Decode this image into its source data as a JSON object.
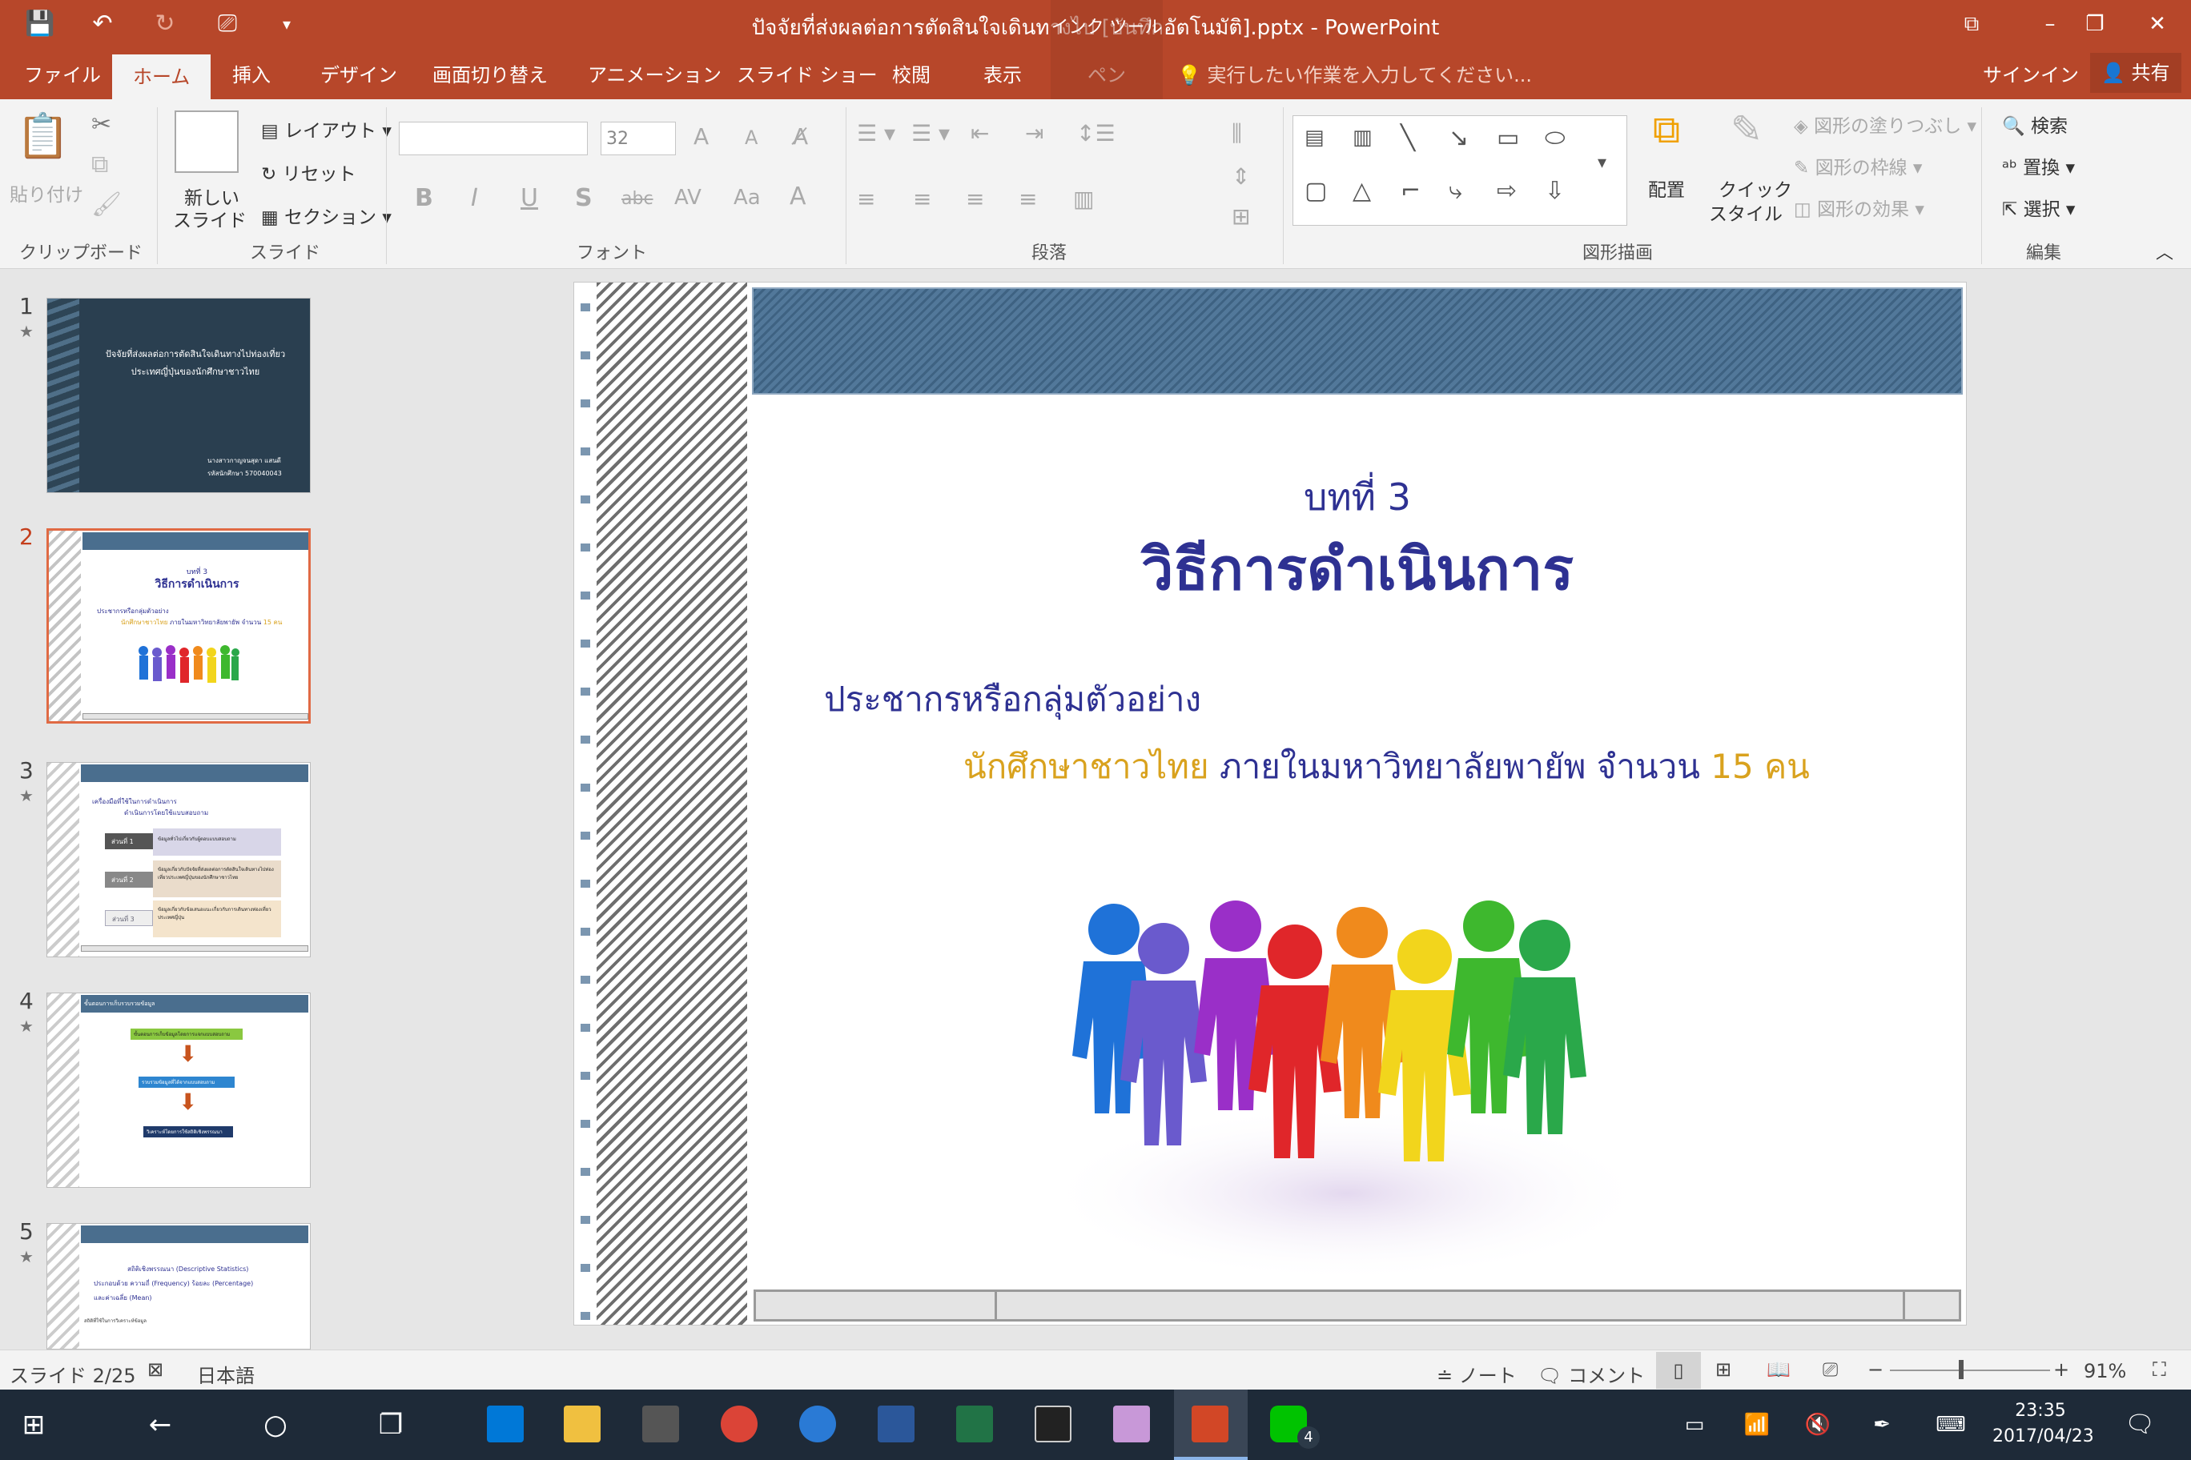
{
  "window": {
    "title": "ปัจจัยที่ส่งผลต่อการตัดสินใจเดินทางไป [บันทึกอัตโนมัติ].pptx - PowerPoint",
    "context_tab_group": "インク ツール",
    "minimize": "–",
    "maximize": "❐",
    "close": "✕",
    "ribbon_display": "⧉"
  },
  "qat": {
    "save": "💾",
    "undo": "↶",
    "redo": "↻",
    "present": "⎚",
    "customize": "▾"
  },
  "tabs": [
    "ファイル",
    "ホーム",
    "挿入",
    "デザイン",
    "画面切り替え",
    "アニメーション",
    "スライド ショー",
    "校閲",
    "表示",
    "ペン"
  ],
  "active_tab": "ホーム",
  "tell_me": "実行したい作業を入力してください...",
  "signin": "サインイン",
  "share": "共有",
  "ribbon": {
    "clipboard": {
      "paste": "貼り付け",
      "group": "クリップボード"
    },
    "slides": {
      "new_slide": "新しい",
      "new_slide2": "スライド",
      "layout": "レイアウト",
      "reset": "リセット",
      "section": "セクション",
      "group": "スライド"
    },
    "font": {
      "font_name": "",
      "font_size": "32",
      "bold": "B",
      "italic": "I",
      "underline": "U",
      "shadow": "S",
      "strike": "abc",
      "spacing": "AV",
      "case": "Aa",
      "color": "A",
      "grow": "A",
      "shrink": "A",
      "group": "フォント"
    },
    "paragraph": {
      "group": "段落"
    },
    "drawing": {
      "arrange": "配置",
      "quick_style": "クイック",
      "quick_style2": "スタイル",
      "fill": "図形の塗りつぶし",
      "outline": "図形の枠線",
      "effects": "図形の効果",
      "group": "図形描画"
    },
    "editing": {
      "find": "検索",
      "replace": "置換",
      "select": "選択",
      "group": "編集"
    }
  },
  "thumbnails": [
    {
      "num": "1",
      "title": "ปัจจัยที่ส่งผลต่อการตัดสินใจเดินทางไปท่องเที่ยว",
      "title2": "ประเทศญี่ปุ่นของนักศึกษาชาวไทย",
      "author": "นางสาวกาญจนสุดา แสนดี",
      "id": "รหัสนักศึกษา 570040043"
    },
    {
      "num": "2",
      "heading": "บทที่ 3",
      "title": "วิธีการดำเนินการ",
      "line1": "ประชากรหรือกลุ่มตัวอย่าง",
      "line2a": "นักศึกษาชาวไทย",
      "line2b": "ภายในมหาวิทยาลัยพายัพ จำนวน",
      "line2c": "15 คน"
    },
    {
      "num": "3",
      "title": "เครื่องมือที่ใช้ในการดำเนินการ",
      "subtitle": "ดำเนินการโดยใช้แบบสอบถาม",
      "parts": [
        {
          "label": "ส่วนที่ 1",
          "text": "ข้อมูลทั่วไปเกี่ยวกับผู้ตอบแบบสอบถาม"
        },
        {
          "label": "ส่วนที่ 2",
          "text": "ข้อมูลเกี่ยวกับปัจจัยที่ส่งผลต่อการตัดสินใจเดินทางไปท่องเที่ยวประเทศญี่ปุ่นของนักศึกษาชาวไทย"
        },
        {
          "label": "ส่วนที่ 3",
          "text": "ข้อมูลเกี่ยวกับข้อเสนอแนะเกี่ยวกับการเดินทางท่องเที่ยวประเทศญี่ปุ่น"
        }
      ]
    },
    {
      "num": "4",
      "header": "ขั้นตอนการเก็บรวบรวมข้อมูล",
      "step1": "ขั้นตอนการเก็บข้อมูลโดยการแจกแบบสอบถาม",
      "step2": "รวบรวมข้อมูลที่ได้จากแบบสอบถาม",
      "step3": "วิเคราะห์โดยการใช้สถิติเชิงพรรณนา"
    },
    {
      "num": "5",
      "title": "สถิติเชิงพรรณนา (Descriptive Statistics)",
      "line1": "ประกอบด้วย ความถี่ (Frequency) ร้อยละ (Percentage)",
      "line2": "และค่าเฉลี่ย (Mean)",
      "note": "สถิติที่ใช้ในการวิเคราะห์ข้อมูล"
    }
  ],
  "slide": {
    "heading": "บทที่ 3",
    "title": "วิธีการดำเนินการ",
    "subheading": "ประชากรหรือกลุ่มตัวอย่าง",
    "detail_a": "นักศึกษาชาวไทย",
    "detail_b": "ภายในมหาวิทยาลัยพายัพ จำนวน",
    "detail_c": "15 คน",
    "colors": {
      "heading": "#2e3192",
      "accent": "#d9a21e",
      "people": [
        "#1f72d8",
        "#6a5acd",
        "#9a2fc8",
        "#e0262a",
        "#f08a1c",
        "#f2d51c",
        "#3eb82e",
        "#2aa84a"
      ]
    }
  },
  "status": {
    "slide": "スライド 2/25",
    "lang": "日本語",
    "notes": "ノート",
    "comments": "コメント",
    "zoom": "91%"
  },
  "taskbar": {
    "time": "23:35",
    "date": "2017/04/23",
    "line_badge": "4"
  }
}
